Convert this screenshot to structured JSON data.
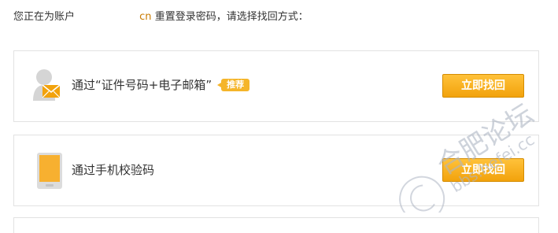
{
  "intro": {
    "prefix": "您正在为账户",
    "account_suffix": "cn",
    "rest": "重置登录密码，请选择找回方式："
  },
  "methods": [
    {
      "label": "通过“证件号码+电子邮箱”",
      "badge": "推荐",
      "button_label": "立即找回",
      "icon": "user-mail-icon"
    },
    {
      "label": "通过手机校验码",
      "button_label": "立即找回",
      "icon": "phone-icon"
    }
  ],
  "watermark": {
    "text": "合肥论坛",
    "domain": "bbs.hefei.cc"
  },
  "colors": {
    "accent": "#f2a20c",
    "accent_light": "#ffc23a",
    "icon_gray": "#d5d5d5",
    "border": "#e2e2e2"
  }
}
